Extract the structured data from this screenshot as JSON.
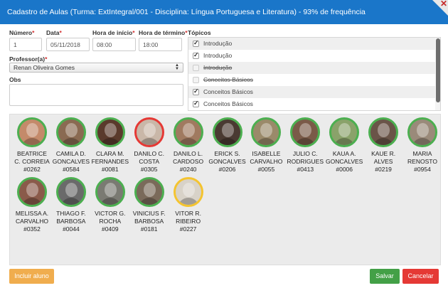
{
  "header": {
    "title": "Cadastro de Aulas (Turma: ExtIntegral/001 - Disciplina: Língua Portuguesa e Literatura) - 93% de frequência",
    "close_symbol": "✕"
  },
  "form": {
    "numero": {
      "label": "Número",
      "value": "1"
    },
    "data": {
      "label": "Data",
      "value": "05/11/2018"
    },
    "hora_inicio": {
      "label": "Hora de início",
      "value": "08:00"
    },
    "hora_termino": {
      "label": "Hora de término",
      "value": "18:00"
    },
    "professor": {
      "label": "Professor(a)",
      "value": "Renan Oliveira Gomes"
    },
    "obs": {
      "label": "Obs",
      "value": ""
    },
    "required_mark": "*"
  },
  "topics": {
    "label": "Tópicos",
    "items": [
      {
        "text": "Introdução",
        "checked": true,
        "disabled": false,
        "strike": false
      },
      {
        "text": "Introdução",
        "checked": true,
        "disabled": false,
        "strike": false
      },
      {
        "text": "Introdução",
        "checked": false,
        "disabled": true,
        "strike": true
      },
      {
        "text": "Conceitos Básicos",
        "checked": false,
        "disabled": true,
        "strike": true
      },
      {
        "text": "Conceitos Básicos",
        "checked": true,
        "disabled": false,
        "strike": false
      },
      {
        "text": "Conceitos Básicos",
        "checked": true,
        "disabled": false,
        "strike": false
      }
    ]
  },
  "students": [
    {
      "name1": "BEATRICE",
      "name2": "C. CORREIA",
      "id": "#0262",
      "status": "present",
      "tone": "#c48a6a"
    },
    {
      "name1": "CAMILA D.",
      "name2": "GONCALVES",
      "id": "#0584",
      "status": "present",
      "tone": "#8a6a52"
    },
    {
      "name1": "CLARA M.",
      "name2": "FERNANDES",
      "id": "#0081",
      "status": "present",
      "tone": "#5a3a2c"
    },
    {
      "name1": "DANILO C.",
      "name2": "COSTA",
      "id": "#0305",
      "status": "absent",
      "tone": "#c9b7a8"
    },
    {
      "name1": "DANILO L.",
      "name2": "CARDOSO",
      "id": "#0240",
      "status": "present",
      "tone": "#a07a60"
    },
    {
      "name1": "ERICK S.",
      "name2": "GONCALVES",
      "id": "#0206",
      "status": "present",
      "tone": "#4a3a32"
    },
    {
      "name1": "ISABELLE",
      "name2": "CARVALHO",
      "id": "#0055",
      "status": "present",
      "tone": "#9a8a6a"
    },
    {
      "name1": "JULIO C.",
      "name2": "RODRIGUES",
      "id": "#0413",
      "status": "present",
      "tone": "#7a5a48"
    },
    {
      "name1": "KAUA A.",
      "name2": "GONCALVES",
      "id": "#0006",
      "status": "present",
      "tone": "#8aa26a"
    },
    {
      "name1": "KAUE R.",
      "name2": "ALVES",
      "id": "#0219",
      "status": "present",
      "tone": "#6a5448"
    },
    {
      "name1": "MARIA",
      "name2": "RENOSTO",
      "id": "#0954",
      "status": "present",
      "tone": "#9a8a7a"
    },
    {
      "name1": "MELISSA A.",
      "name2": "CARVALHO",
      "id": "#0352",
      "status": "present",
      "tone": "#8a5a4a"
    },
    {
      "name1": "THIAGO F.",
      "name2": "BARBOSA",
      "id": "#0044",
      "status": "present",
      "tone": "#6a6a6a"
    },
    {
      "name1": "VICTOR G.",
      "name2": "ROCHA",
      "id": "#0409",
      "status": "present",
      "tone": "#7a7a72"
    },
    {
      "name1": "VINICIUS F.",
      "name2": "BARBOSA",
      "id": "#0181",
      "status": "present",
      "tone": "#7a6a5a"
    },
    {
      "name1": "VITOR R.",
      "name2": "RIBEIRO",
      "id": "#0227",
      "status": "partial",
      "tone": "#d8d2c8"
    }
  ],
  "buttons": {
    "add": "Incluir aluno",
    "save": "Salvar",
    "cancel": "Cancelar"
  },
  "colors": {
    "header": "#1a76c9",
    "present": "#4caf50",
    "absent": "#e53935",
    "partial": "#f4c430",
    "add": "#f0ad4e",
    "save": "#43a047",
    "cancel": "#e53935"
  }
}
